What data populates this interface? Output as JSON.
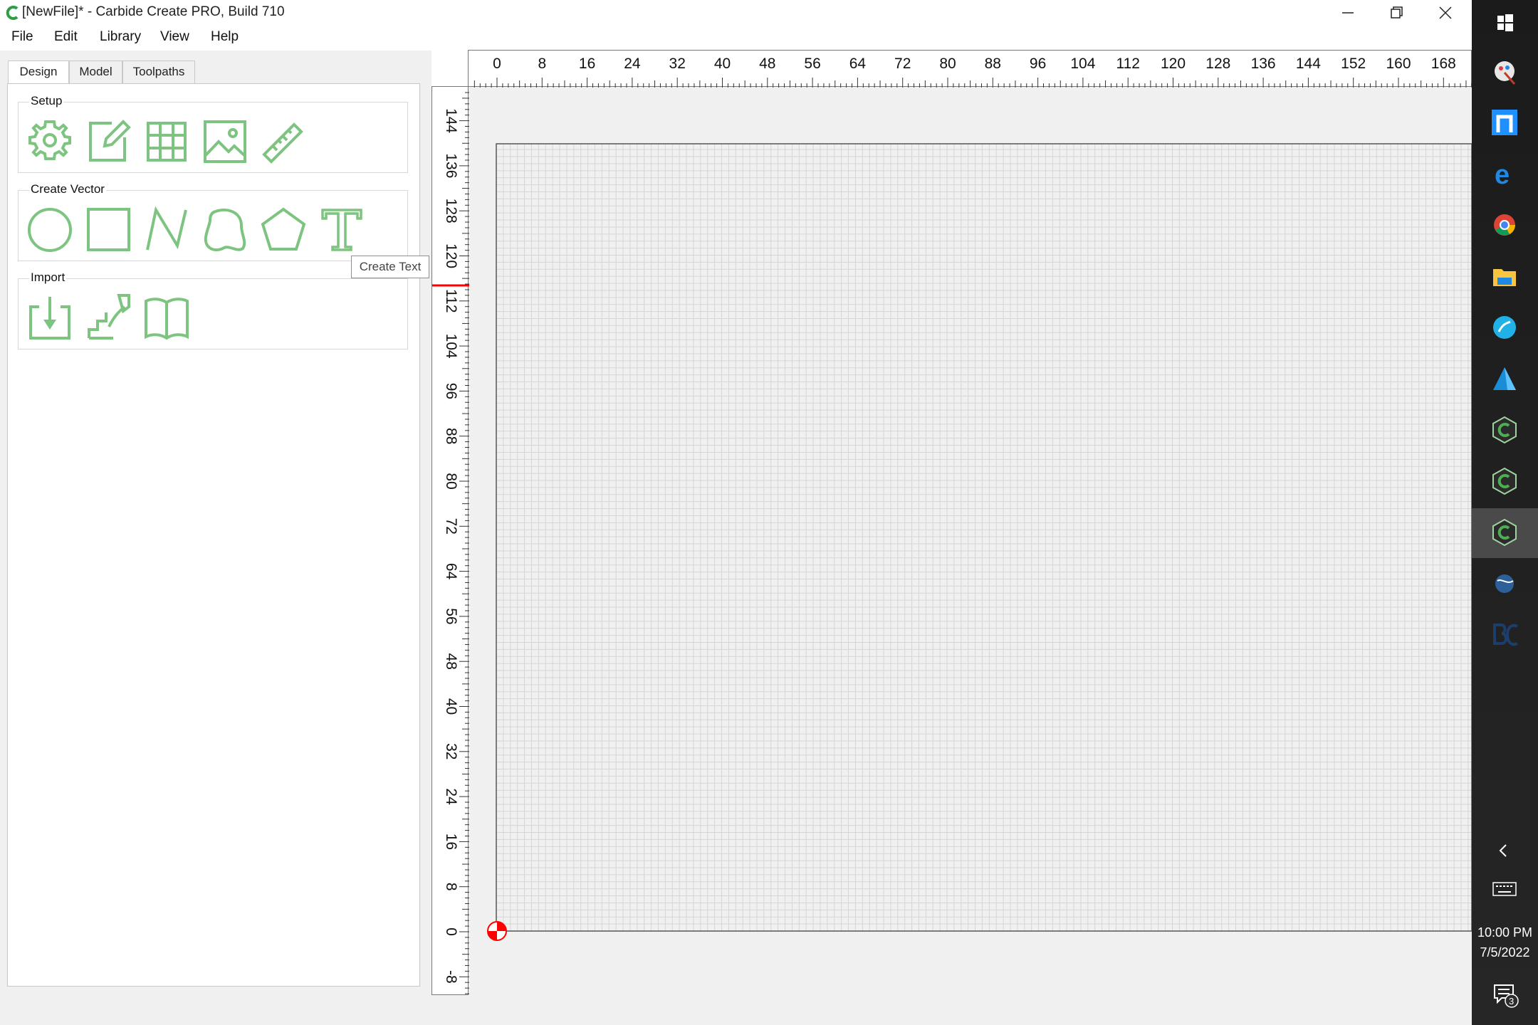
{
  "window": {
    "title": "[NewFile]* - Carbide Create PRO, Build 710"
  },
  "menu": [
    {
      "label": "File"
    },
    {
      "label": "Edit"
    },
    {
      "label": "Library"
    },
    {
      "label": "View"
    },
    {
      "label": "Help"
    }
  ],
  "tabs": [
    {
      "label": "Design"
    },
    {
      "label": "Model"
    },
    {
      "label": "Toolpaths"
    }
  ],
  "groups": {
    "setup": "Setup",
    "create_vector": "Create Vector",
    "import": "Import"
  },
  "tooltip": "Create Text",
  "ruler": {
    "x_labels": [
      "0",
      "8",
      "16",
      "24",
      "32",
      "40",
      "48",
      "56",
      "64",
      "72",
      "80",
      "88",
      "96",
      "104",
      "112",
      "120",
      "128",
      "136",
      "144",
      "152",
      "160",
      "168"
    ],
    "y_labels": [
      "-8",
      "0",
      "8",
      "16",
      "24",
      "32",
      "40",
      "48",
      "56",
      "64",
      "72",
      "80",
      "88",
      "96",
      "104",
      "112",
      "120",
      "128",
      "136",
      "144"
    ]
  },
  "tray": {
    "time": "10:00 PM",
    "date": "7/5/2022",
    "notification_count": "3"
  },
  "colors": {
    "tool_green": "#7cc47f",
    "accent_red": "#ff0000",
    "grid_line": "#d5d5d5"
  }
}
